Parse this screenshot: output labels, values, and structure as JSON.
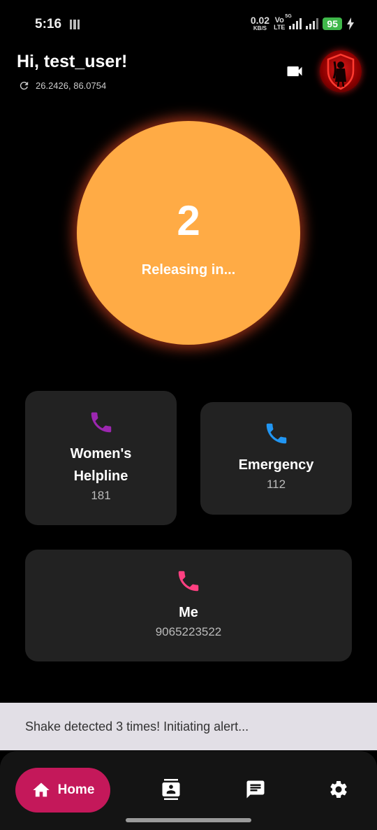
{
  "status_bar": {
    "time": "5:16",
    "net_speed_value": "0.02",
    "net_speed_unit": "KB/S",
    "volte_top": "Vo",
    "volte_bottom": "LTE",
    "network_tag": "5G",
    "battery": "95"
  },
  "header": {
    "greeting": "Hi, test_user!",
    "coordinates": "26.2426, 86.0754",
    "icons": [
      "refresh-icon",
      "videocam-icon",
      "shield-avatar"
    ]
  },
  "countdown": {
    "value": "2",
    "label": "Releasing in..."
  },
  "contacts": [
    {
      "name": "Women's Helpline",
      "name_line1": "Women's",
      "name_line2": "Helpline",
      "number": "181",
      "icon": "phone-icon",
      "color": "#9c27b0"
    },
    {
      "name": "Emergency",
      "number": "112",
      "icon": "phone-icon",
      "color": "#2196f3"
    },
    {
      "name": "Me",
      "number": "9065223522",
      "icon": "phone-icon",
      "color": "#ff4081"
    }
  ],
  "snackbar": {
    "message": "Shake detected 3 times! Initiating alert..."
  },
  "nav": {
    "home_label": "Home",
    "items": [
      "home-icon",
      "contacts-icon",
      "chat-icon",
      "settings-icon"
    ],
    "accent": "#c4185a"
  },
  "colors": {
    "countdown": "#ffab45",
    "card": "#222222",
    "background": "#000000"
  }
}
